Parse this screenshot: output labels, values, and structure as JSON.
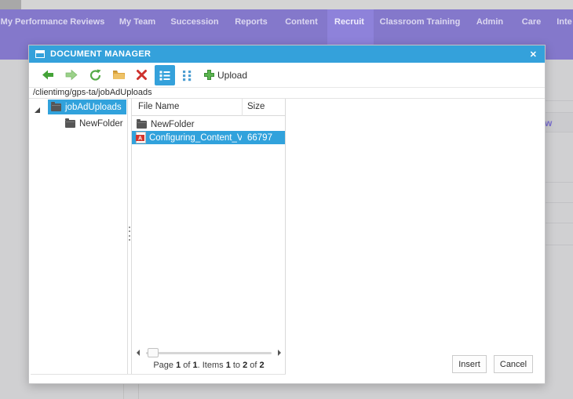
{
  "nav": {
    "items": [
      {
        "label": "My Performance Reviews"
      },
      {
        "label": "My Team"
      },
      {
        "label": "Succession"
      },
      {
        "label": "Reports"
      },
      {
        "label": "Content"
      },
      {
        "label": "Recruit",
        "active": true
      },
      {
        "label": "Classroom Training"
      },
      {
        "label": "Admin"
      },
      {
        "label": "Care"
      },
      {
        "label": "Inte"
      }
    ]
  },
  "backdrop": {
    "partial_text": "w"
  },
  "dialog": {
    "title": "DOCUMENT MANAGER",
    "close_label": "✕",
    "toolbar": {
      "icons": [
        "back-icon",
        "forward-icon",
        "refresh-icon",
        "new-folder-icon",
        "delete-icon",
        "list-view-icon",
        "grid-view-icon",
        "upload-plus-icon"
      ],
      "upload_label": "Upload"
    },
    "address_path": "/clientimg/gps-ta/jobAdUploads",
    "tree": {
      "root_label": "jobAdUploads",
      "child_label": "NewFolder"
    },
    "list": {
      "col_file_name": "File Name",
      "col_size": "Size",
      "rows": [
        {
          "name": "NewFolder",
          "type": "folder",
          "size": ""
        },
        {
          "name": "Configuring_Content_Vendor",
          "type": "pdf",
          "size": "66797",
          "selected": true
        }
      ],
      "pager": {
        "t1": "Page ",
        "n1": "1",
        "t2": " of ",
        "n2": "1",
        "t3": ". Items ",
        "n3": "1",
        "t4": " to ",
        "n4": "2",
        "t5": " of ",
        "n5": "2"
      }
    },
    "buttons": {
      "insert": "Insert",
      "cancel": "Cancel"
    },
    "colors": {
      "accent_blue": "#34a1db",
      "nav_purple": "#8478cb",
      "nav_active": "#8e82da"
    }
  }
}
